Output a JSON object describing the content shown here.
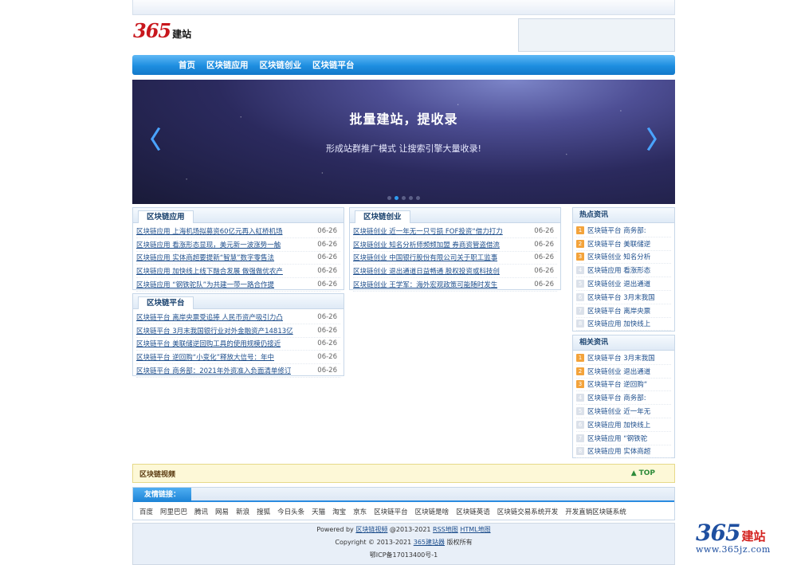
{
  "header": {
    "logo_num": "365",
    "logo_text": "建站"
  },
  "nav": {
    "items": [
      "首页",
      "区块链应用",
      "区块链创业",
      "区块链平台"
    ]
  },
  "banner": {
    "title": "批量建站，提收录",
    "subtitle": "形成站群推广模式 让搜索引擎大量收录!",
    "prev": "〈",
    "next": "〉"
  },
  "section_apps": {
    "title": "区块链应用",
    "items": [
      {
        "text": "区块链应用 上海机场拟募资60亿元再入虹桥机场",
        "date": "06-26"
      },
      {
        "text": "区块链应用 看涨形态显现，美元新一波涨势一触",
        "date": "06-26"
      },
      {
        "text": "区块链应用 实体商超要提新“智慧”数字零售法",
        "date": "06-26"
      },
      {
        "text": "区块链应用 加快线上线下融合发展 做强做优农产",
        "date": "06-26"
      },
      {
        "text": "区块链应用 “钢铁驼队”为共建一带一路合作提",
        "date": "06-26"
      }
    ]
  },
  "section_startup": {
    "title": "区块链创业",
    "items": [
      {
        "text": "区块链创业 近一年无一只亏损 FOF投资“借力打力",
        "date": "06-26"
      },
      {
        "text": "区块链创业 知名分析师频频加盟 券商资管盗借流",
        "date": "06-26"
      },
      {
        "text": "区块链创业 中国银行股份有限公司关于职工监事",
        "date": "06-26"
      },
      {
        "text": "区块链创业 退出通道日益畅通 股权投资或科技创",
        "date": "06-26"
      },
      {
        "text": "区块链创业 王学军：海外宏观政策可能随时发生",
        "date": "06-26"
      }
    ]
  },
  "section_platform": {
    "title": "区块链平台",
    "items": [
      {
        "text": "区块链平台 离岸央票受追捧 人民币资产吸引力凸",
        "date": "06-26"
      },
      {
        "text": "区块链平台 3月末我国银行业对外金融资产14813亿",
        "date": "06-26"
      },
      {
        "text": "区块链平台 美联储逆回购工具的使用规模仍接近",
        "date": "06-26"
      },
      {
        "text": "区块链平台 逆回购“小变化”释放大信号：年中",
        "date": "06-26"
      },
      {
        "text": "区块链平台 商务部：2021年外资准入负面清单修订",
        "date": "06-26"
      }
    ]
  },
  "hot_news": {
    "title": "热点资讯",
    "items": [
      {
        "n": "1",
        "text": "区块链平台 商务部:",
        "hot": true
      },
      {
        "n": "2",
        "text": "区块链平台 美联储逆",
        "hot": true
      },
      {
        "n": "3",
        "text": "区块链创业 知名分析",
        "hot": true
      },
      {
        "n": "4",
        "text": "区块链应用 看涨形态",
        "hot": false
      },
      {
        "n": "5",
        "text": "区块链创业 退出通道",
        "hot": false
      },
      {
        "n": "6",
        "text": "区块链平台 3月末我国",
        "hot": false
      },
      {
        "n": "7",
        "text": "区块链平台 离岸央票",
        "hot": false
      },
      {
        "n": "8",
        "text": "区块链应用 加快线上",
        "hot": false
      }
    ]
  },
  "related_news": {
    "title": "相关资讯",
    "items": [
      {
        "n": "1",
        "text": "区块链平台 3月末我国",
        "hot": true
      },
      {
        "n": "2",
        "text": "区块链创业 退出通道",
        "hot": true
      },
      {
        "n": "3",
        "text": "区块链平台 逆回购“",
        "hot": true
      },
      {
        "n": "4",
        "text": "区块链平台 商务部:",
        "hot": false
      },
      {
        "n": "5",
        "text": "区块链创业 近一年无",
        "hot": false
      },
      {
        "n": "6",
        "text": "区块链应用 加快线上",
        "hot": false
      },
      {
        "n": "7",
        "text": "区块链应用 “钢铁驼",
        "hot": false
      },
      {
        "n": "8",
        "text": "区块链应用 实体商超",
        "hot": false
      }
    ]
  },
  "video_bar": {
    "title": "区块链视频",
    "top_label": "TOP"
  },
  "friends": {
    "title": "友情链接：",
    "links": [
      "百度",
      "阿里巴巴",
      "腾讯",
      "网易",
      "新浪",
      "搜狐",
      "今日头条",
      "天猫",
      "淘宝",
      "京东",
      "区块链平台",
      "区块链是啥",
      "区块链英语",
      "区块链交易系统开发",
      "开发直销区块链系统"
    ]
  },
  "footer": {
    "powered_prefix": "Powered by",
    "powered_link": "区块链视频",
    "powered_suffix": "@2013-2021",
    "rss": "RSS地图",
    "html": "HTML地图",
    "copyright_prefix": "Copyright © 2013-2021",
    "copyright_link": "365建站器",
    "copyright_suffix": "版权所有",
    "icp": "鄂ICP备17013400号-1"
  },
  "watermark": {
    "num": "365",
    "text": "建站",
    "url": "www.365jz.com"
  },
  "colors": {
    "nav_blue": "#1e8ee0",
    "link_blue": "#1d4e8c",
    "hot_orange": "#f3a33b",
    "logo_red": "#c8171d"
  }
}
